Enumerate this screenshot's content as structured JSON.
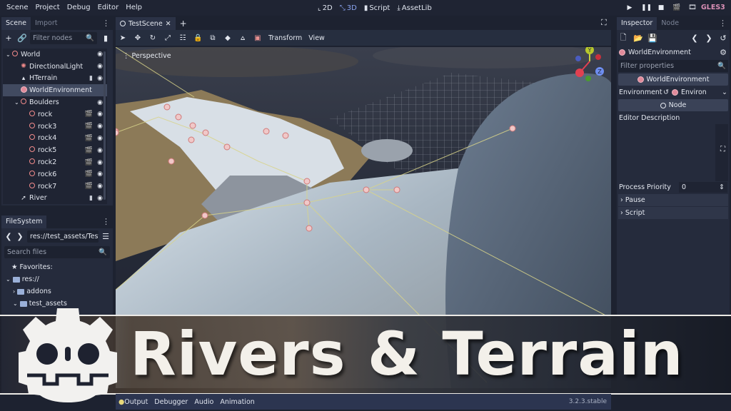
{
  "menu": [
    "Scene",
    "Project",
    "Debug",
    "Editor",
    "Help"
  ],
  "main_screens": [
    {
      "label": "2D",
      "icon": "2d-icon",
      "active": false
    },
    {
      "label": "3D",
      "icon": "3d-icon",
      "active": true
    },
    {
      "label": "Script",
      "icon": "script-icon",
      "active": false
    },
    {
      "label": "AssetLib",
      "icon": "assetlib-icon",
      "active": false
    }
  ],
  "play_buttons": [
    "play",
    "pause",
    "stop",
    "play-scene",
    "play-custom-scene"
  ],
  "renderer": "GLES3",
  "scene_dock": {
    "tabs": [
      "Scene",
      "Import"
    ],
    "active_tab": "Scene",
    "filter_placeholder": "Filter nodes",
    "tree": [
      {
        "name": "World",
        "indent": 0,
        "icon": "spatial",
        "expand": "open",
        "extra": "",
        "visible": true
      },
      {
        "name": "DirectionalLight",
        "indent": 1,
        "icon": "light",
        "expand": "",
        "extra": "",
        "visible": true
      },
      {
        "name": "HTerrain",
        "indent": 1,
        "icon": "terrain",
        "expand": "",
        "extra": "script",
        "visible": true
      },
      {
        "name": "WorldEnvironment",
        "indent": 1,
        "icon": "globe",
        "expand": "",
        "extra": "",
        "visible": null,
        "selected": true
      },
      {
        "name": "Boulders",
        "indent": 1,
        "icon": "spatial",
        "expand": "open",
        "extra": "",
        "visible": true
      },
      {
        "name": "rock",
        "indent": 2,
        "icon": "spatial",
        "expand": "",
        "extra": "instance",
        "visible": true
      },
      {
        "name": "rock3",
        "indent": 2,
        "icon": "spatial",
        "expand": "",
        "extra": "instance",
        "visible": true
      },
      {
        "name": "rock4",
        "indent": 2,
        "icon": "spatial",
        "expand": "",
        "extra": "instance",
        "visible": true
      },
      {
        "name": "rock5",
        "indent": 2,
        "icon": "spatial",
        "expand": "",
        "extra": "instance",
        "visible": true
      },
      {
        "name": "rock2",
        "indent": 2,
        "icon": "spatial",
        "expand": "",
        "extra": "instance",
        "visible": true
      },
      {
        "name": "rock6",
        "indent": 2,
        "icon": "spatial",
        "expand": "",
        "extra": "instance",
        "visible": true
      },
      {
        "name": "rock7",
        "indent": 2,
        "icon": "spatial",
        "expand": "",
        "extra": "instance",
        "visible": true
      },
      {
        "name": "River",
        "indent": 1,
        "icon": "river",
        "expand": "",
        "extra": "script",
        "visible": true
      }
    ]
  },
  "filesystem_dock": {
    "tab": "FileSystem",
    "path": "res://test_assets/TestS",
    "search_placeholder": "Search files",
    "items": [
      {
        "label": "Favorites:",
        "type": "favorites",
        "indent": 0
      },
      {
        "label": "res://",
        "type": "folder",
        "indent": 0,
        "expand": "open"
      },
      {
        "label": "addons",
        "type": "folder",
        "indent": 1,
        "expand": "closed"
      },
      {
        "label": "test_assets",
        "type": "folder",
        "indent": 1,
        "expand": "open"
      }
    ]
  },
  "editor": {
    "scene_tab": "TestScene",
    "toolbar_menus": [
      "Transform",
      "View"
    ],
    "viewport_label": "Perspective",
    "gizmo_axes": [
      "Y",
      "Z"
    ]
  },
  "inspector": {
    "tabs": [
      "Inspector",
      "Node"
    ],
    "active_tab": "Inspector",
    "object": "WorldEnvironment",
    "filter_placeholder": "Filter properties",
    "class_header": "WorldEnvironment",
    "properties": [
      {
        "label": "Environment",
        "value": "Environ"
      }
    ],
    "node_header": "Node",
    "editor_description_label": "Editor Description",
    "process_priority_label": "Process Priority",
    "process_priority_value": "0",
    "sections": [
      "Pause",
      "Script"
    ]
  },
  "bottom_panel": {
    "tabs": [
      "Output",
      "Debugger",
      "Audio",
      "Animation"
    ],
    "version": "3.2.3.stable"
  },
  "banner": {
    "title": "Rivers & Terrain"
  }
}
